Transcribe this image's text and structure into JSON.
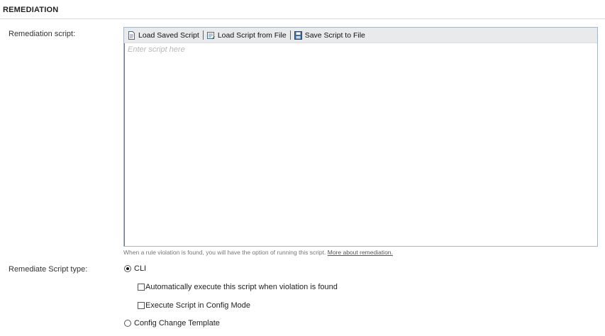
{
  "section": {
    "title": "REMEDIATION"
  },
  "remediation_script": {
    "label": "Remediation script:",
    "toolbar": {
      "load_saved": "Load Saved Script",
      "load_file": "Load Script from File",
      "save_file": "Save Script to File"
    },
    "placeholder": "Enter script here",
    "value": ""
  },
  "hint": {
    "text": "When a rule violation is found, you will have the option of running this script. ",
    "link": "More about remediation."
  },
  "script_type": {
    "label": "Remediate Script type:",
    "options": [
      {
        "label": "CLI",
        "checked": true
      },
      {
        "label": "Config Change Template",
        "checked": false
      }
    ],
    "cli_options": [
      {
        "label": "Automatically execute this script when violation is found",
        "checked": false
      },
      {
        "label": "Execute Script in Config Mode",
        "checked": false
      }
    ]
  }
}
